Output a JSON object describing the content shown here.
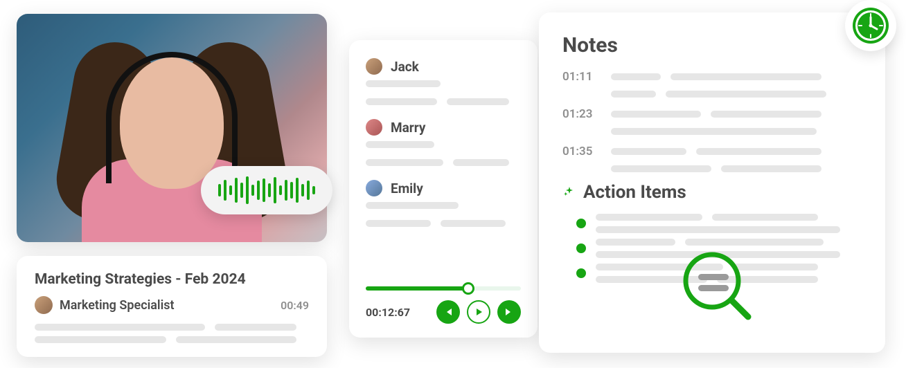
{
  "colors": {
    "accent": "#17a513",
    "text": "#4a4a4a",
    "muted": "#8f8f8f"
  },
  "video": {
    "waveform_icon": "audio-waveform-icon"
  },
  "meeting": {
    "title": "Marketing Strategies - Feb 2024",
    "role": "Marketing Specialist",
    "duration": "00:49"
  },
  "transcript": {
    "speakers": [
      {
        "name": "Jack"
      },
      {
        "name": "Marry"
      },
      {
        "name": "Emily"
      }
    ],
    "elapsed": "00:12:67",
    "progress_pct": 66
  },
  "notes": {
    "title": "Notes",
    "entries": [
      {
        "ts": "01:11"
      },
      {
        "ts": "01:23"
      },
      {
        "ts": "01:35"
      }
    ],
    "action_items_title": "Action Items"
  },
  "icons": {
    "sparkle": "sparkle-icon",
    "clock": "clock-icon",
    "magnifier": "magnifier-icon",
    "prev": "previous-track-icon",
    "play": "play-icon",
    "next": "next-track-icon"
  }
}
